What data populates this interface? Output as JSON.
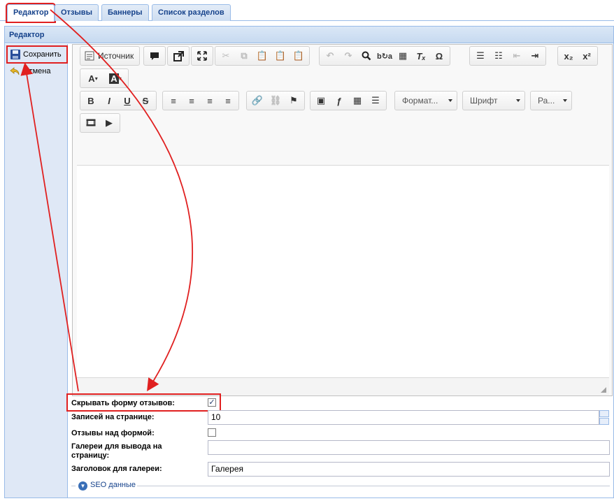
{
  "tabs": [
    {
      "label": "Редактор",
      "active": true
    },
    {
      "label": "Отзывы",
      "active": false
    },
    {
      "label": "Баннеры",
      "active": false
    },
    {
      "label": "Список разделов",
      "active": false
    }
  ],
  "panel": {
    "title": "Редактор"
  },
  "sidebar": {
    "save_label": "Сохранить",
    "cancel_label": "Отмена"
  },
  "toolbar": {
    "source_label": "Источник",
    "format_combo": "Формат...",
    "font_combo": "Шрифт",
    "size_combo": "Ра..."
  },
  "form": {
    "hide_form": {
      "label": "Скрывать форму отзывов:",
      "checked": true
    },
    "per_page": {
      "label": "Записей на странице:",
      "value": "10"
    },
    "reviews_above": {
      "label": "Отзывы над формой:",
      "checked": false
    },
    "galleries": {
      "label": "Галереи для вывода на страницу:",
      "value": ""
    },
    "gallery_title": {
      "label": "Заголовок для галереи:",
      "value": "Галерея"
    }
  },
  "seo": {
    "label": "SEO данные"
  },
  "colors": {
    "highlight": "#e02020",
    "accent": "#15428b",
    "panel_border": "#99bbe8"
  }
}
